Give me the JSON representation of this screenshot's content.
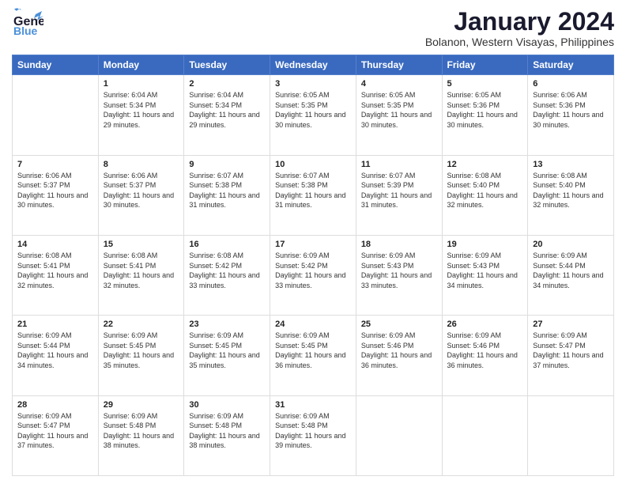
{
  "header": {
    "logo_general": "General",
    "logo_blue": "Blue",
    "title": "January 2024",
    "subtitle": "Bolanon, Western Visayas, Philippines"
  },
  "days_of_week": [
    "Sunday",
    "Monday",
    "Tuesday",
    "Wednesday",
    "Thursday",
    "Friday",
    "Saturday"
  ],
  "weeks": [
    [
      {
        "day": "",
        "info": ""
      },
      {
        "day": "1",
        "info": "Sunrise: 6:04 AM\nSunset: 5:34 PM\nDaylight: 11 hours\nand 29 minutes."
      },
      {
        "day": "2",
        "info": "Sunrise: 6:04 AM\nSunset: 5:34 PM\nDaylight: 11 hours\nand 29 minutes."
      },
      {
        "day": "3",
        "info": "Sunrise: 6:05 AM\nSunset: 5:35 PM\nDaylight: 11 hours\nand 30 minutes."
      },
      {
        "day": "4",
        "info": "Sunrise: 6:05 AM\nSunset: 5:35 PM\nDaylight: 11 hours\nand 30 minutes."
      },
      {
        "day": "5",
        "info": "Sunrise: 6:05 AM\nSunset: 5:36 PM\nDaylight: 11 hours\nand 30 minutes."
      },
      {
        "day": "6",
        "info": "Sunrise: 6:06 AM\nSunset: 5:36 PM\nDaylight: 11 hours\nand 30 minutes."
      }
    ],
    [
      {
        "day": "7",
        "info": "Sunrise: 6:06 AM\nSunset: 5:37 PM\nDaylight: 11 hours\nand 30 minutes."
      },
      {
        "day": "8",
        "info": "Sunrise: 6:06 AM\nSunset: 5:37 PM\nDaylight: 11 hours\nand 30 minutes."
      },
      {
        "day": "9",
        "info": "Sunrise: 6:07 AM\nSunset: 5:38 PM\nDaylight: 11 hours\nand 31 minutes."
      },
      {
        "day": "10",
        "info": "Sunrise: 6:07 AM\nSunset: 5:38 PM\nDaylight: 11 hours\nand 31 minutes."
      },
      {
        "day": "11",
        "info": "Sunrise: 6:07 AM\nSunset: 5:39 PM\nDaylight: 11 hours\nand 31 minutes."
      },
      {
        "day": "12",
        "info": "Sunrise: 6:08 AM\nSunset: 5:40 PM\nDaylight: 11 hours\nand 32 minutes."
      },
      {
        "day": "13",
        "info": "Sunrise: 6:08 AM\nSunset: 5:40 PM\nDaylight: 11 hours\nand 32 minutes."
      }
    ],
    [
      {
        "day": "14",
        "info": "Sunrise: 6:08 AM\nSunset: 5:41 PM\nDaylight: 11 hours\nand 32 minutes."
      },
      {
        "day": "15",
        "info": "Sunrise: 6:08 AM\nSunset: 5:41 PM\nDaylight: 11 hours\nand 32 minutes."
      },
      {
        "day": "16",
        "info": "Sunrise: 6:08 AM\nSunset: 5:42 PM\nDaylight: 11 hours\nand 33 minutes."
      },
      {
        "day": "17",
        "info": "Sunrise: 6:09 AM\nSunset: 5:42 PM\nDaylight: 11 hours\nand 33 minutes."
      },
      {
        "day": "18",
        "info": "Sunrise: 6:09 AM\nSunset: 5:43 PM\nDaylight: 11 hours\nand 33 minutes."
      },
      {
        "day": "19",
        "info": "Sunrise: 6:09 AM\nSunset: 5:43 PM\nDaylight: 11 hours\nand 34 minutes."
      },
      {
        "day": "20",
        "info": "Sunrise: 6:09 AM\nSunset: 5:44 PM\nDaylight: 11 hours\nand 34 minutes."
      }
    ],
    [
      {
        "day": "21",
        "info": "Sunrise: 6:09 AM\nSunset: 5:44 PM\nDaylight: 11 hours\nand 34 minutes."
      },
      {
        "day": "22",
        "info": "Sunrise: 6:09 AM\nSunset: 5:45 PM\nDaylight: 11 hours\nand 35 minutes."
      },
      {
        "day": "23",
        "info": "Sunrise: 6:09 AM\nSunset: 5:45 PM\nDaylight: 11 hours\nand 35 minutes."
      },
      {
        "day": "24",
        "info": "Sunrise: 6:09 AM\nSunset: 5:45 PM\nDaylight: 11 hours\nand 36 minutes."
      },
      {
        "day": "25",
        "info": "Sunrise: 6:09 AM\nSunset: 5:46 PM\nDaylight: 11 hours\nand 36 minutes."
      },
      {
        "day": "26",
        "info": "Sunrise: 6:09 AM\nSunset: 5:46 PM\nDaylight: 11 hours\nand 36 minutes."
      },
      {
        "day": "27",
        "info": "Sunrise: 6:09 AM\nSunset: 5:47 PM\nDaylight: 11 hours\nand 37 minutes."
      }
    ],
    [
      {
        "day": "28",
        "info": "Sunrise: 6:09 AM\nSunset: 5:47 PM\nDaylight: 11 hours\nand 37 minutes."
      },
      {
        "day": "29",
        "info": "Sunrise: 6:09 AM\nSunset: 5:48 PM\nDaylight: 11 hours\nand 38 minutes."
      },
      {
        "day": "30",
        "info": "Sunrise: 6:09 AM\nSunset: 5:48 PM\nDaylight: 11 hours\nand 38 minutes."
      },
      {
        "day": "31",
        "info": "Sunrise: 6:09 AM\nSunset: 5:48 PM\nDaylight: 11 hours\nand 39 minutes."
      },
      {
        "day": "",
        "info": ""
      },
      {
        "day": "",
        "info": ""
      },
      {
        "day": "",
        "info": ""
      }
    ]
  ]
}
